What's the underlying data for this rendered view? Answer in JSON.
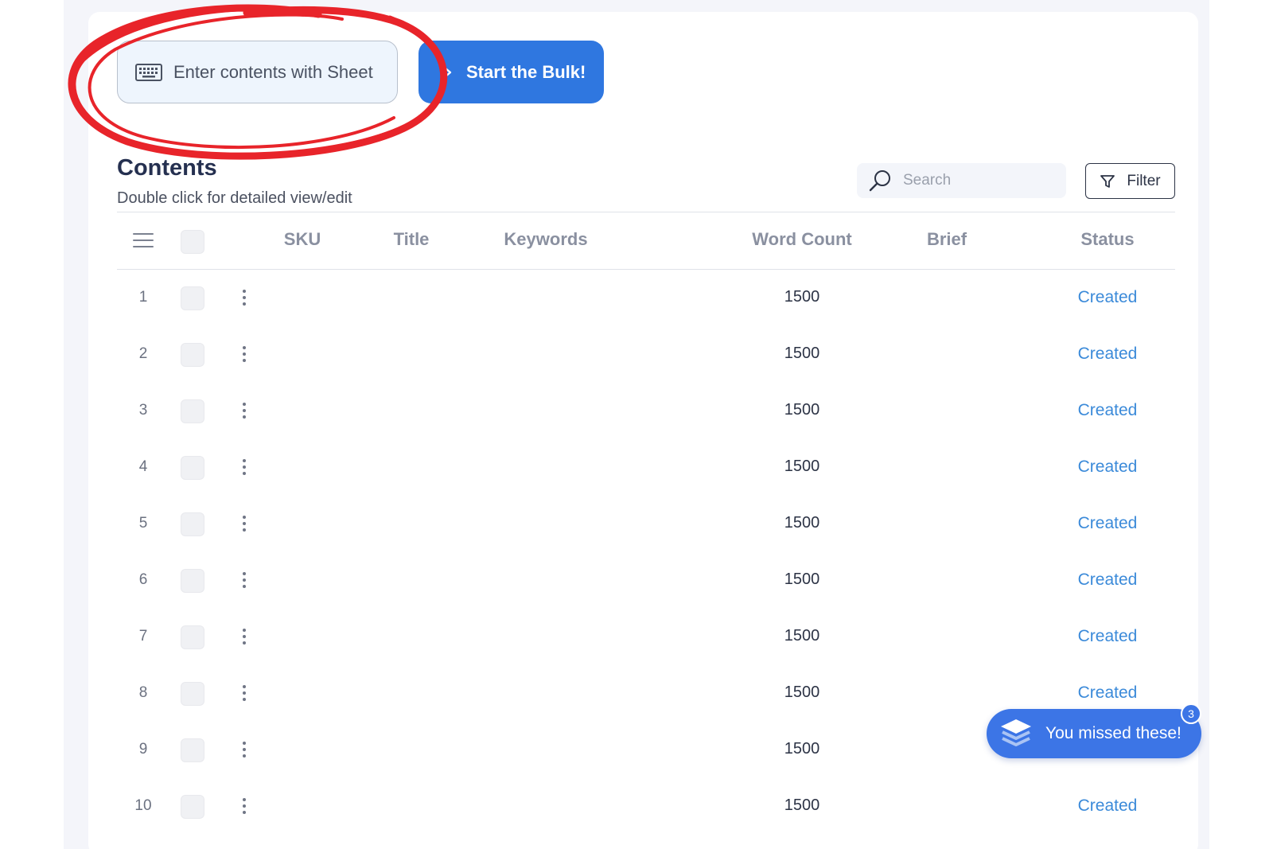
{
  "toolbar": {
    "sheet_label": "Enter contents with Sheet",
    "bulk_label": "Start the Bulk!"
  },
  "header": {
    "title": "Contents",
    "subtitle": "Double click for detailed view/edit"
  },
  "search": {
    "placeholder": "Search"
  },
  "filter": {
    "label": "Filter"
  },
  "table": {
    "columns": [
      "SKU",
      "Title",
      "Keywords",
      "Word Count",
      "Brief",
      "Status"
    ],
    "rows": [
      {
        "num": "1",
        "word_count": "1500",
        "status": "Created"
      },
      {
        "num": "2",
        "word_count": "1500",
        "status": "Created"
      },
      {
        "num": "3",
        "word_count": "1500",
        "status": "Created"
      },
      {
        "num": "4",
        "word_count": "1500",
        "status": "Created"
      },
      {
        "num": "5",
        "word_count": "1500",
        "status": "Created"
      },
      {
        "num": "6",
        "word_count": "1500",
        "status": "Created"
      },
      {
        "num": "7",
        "word_count": "1500",
        "status": "Created"
      },
      {
        "num": "8",
        "word_count": "1500",
        "status": "Created"
      },
      {
        "num": "9",
        "word_count": "1500",
        "status": ""
      },
      {
        "num": "10",
        "word_count": "1500",
        "status": "Created"
      }
    ]
  },
  "toast": {
    "label": "You missed these!",
    "badge": "3"
  },
  "icons": {
    "sheet": "keyboard-icon",
    "bulk": "play-icon",
    "search": "search-icon",
    "filter": "filter-icon",
    "columns": "menu-icon",
    "row_actions": "kebab-icon",
    "toast": "layers-icon"
  },
  "colors": {
    "primary": "#2f77e0",
    "status_created": "#3b8ad9",
    "annotation": "#e8242a"
  }
}
